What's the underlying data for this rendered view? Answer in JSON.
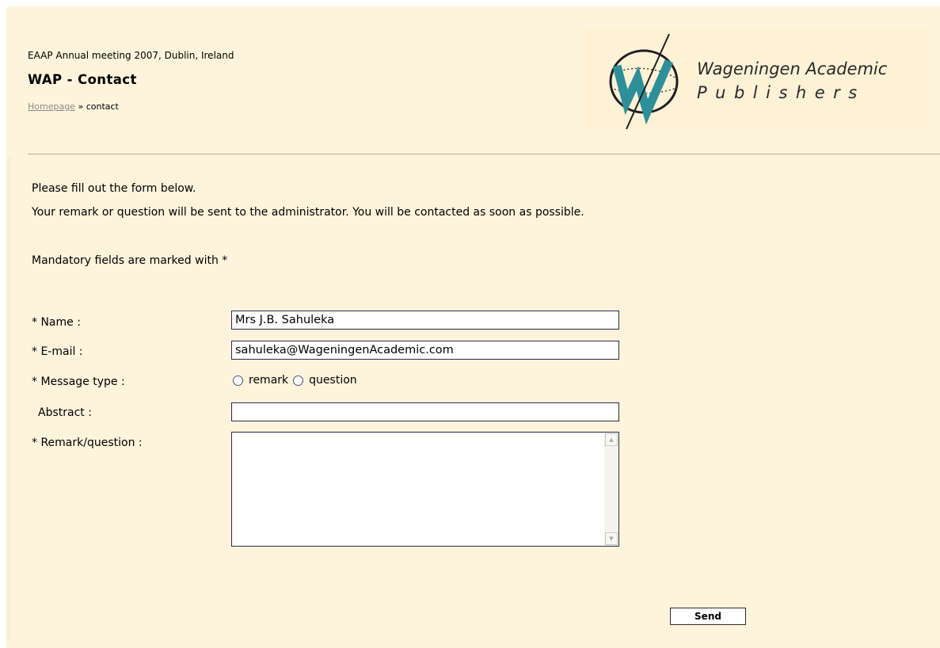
{
  "header": {
    "event_title": "EAAP Annual meeting 2007, Dublin, Ireland",
    "page_title": "WAP - Contact",
    "breadcrumb": {
      "home_link": "Homepage",
      "separator": "»",
      "current": "contact"
    }
  },
  "logo": {
    "name_line1": "Wageningen Academic",
    "name_line2": "Publishers",
    "emblem_letter": "W",
    "color": "#2e8f98"
  },
  "intro": {
    "line1": "Please fill out the form below.",
    "line2": "Your remark or question will be sent to the administrator. You will be contacted as soon as possible.",
    "mandatory_note": "Mandatory fields are marked with *"
  },
  "form": {
    "name": {
      "label": "* Name :",
      "value": "Mrs J.B. Sahuleka"
    },
    "email": {
      "label": "* E-mail :",
      "value": "sahuleka@WageningenAcademic.com"
    },
    "message_type": {
      "label": "* Message type :",
      "options": [
        "remark",
        "question"
      ],
      "selected": null
    },
    "abstract": {
      "label": "Abstract :",
      "value": ""
    },
    "remark": {
      "label": "* Remark/question :",
      "value": ""
    },
    "send_label": "Send"
  },
  "colors": {
    "page_background": "#fef4dc",
    "logo_accent": "#2e8f98"
  }
}
